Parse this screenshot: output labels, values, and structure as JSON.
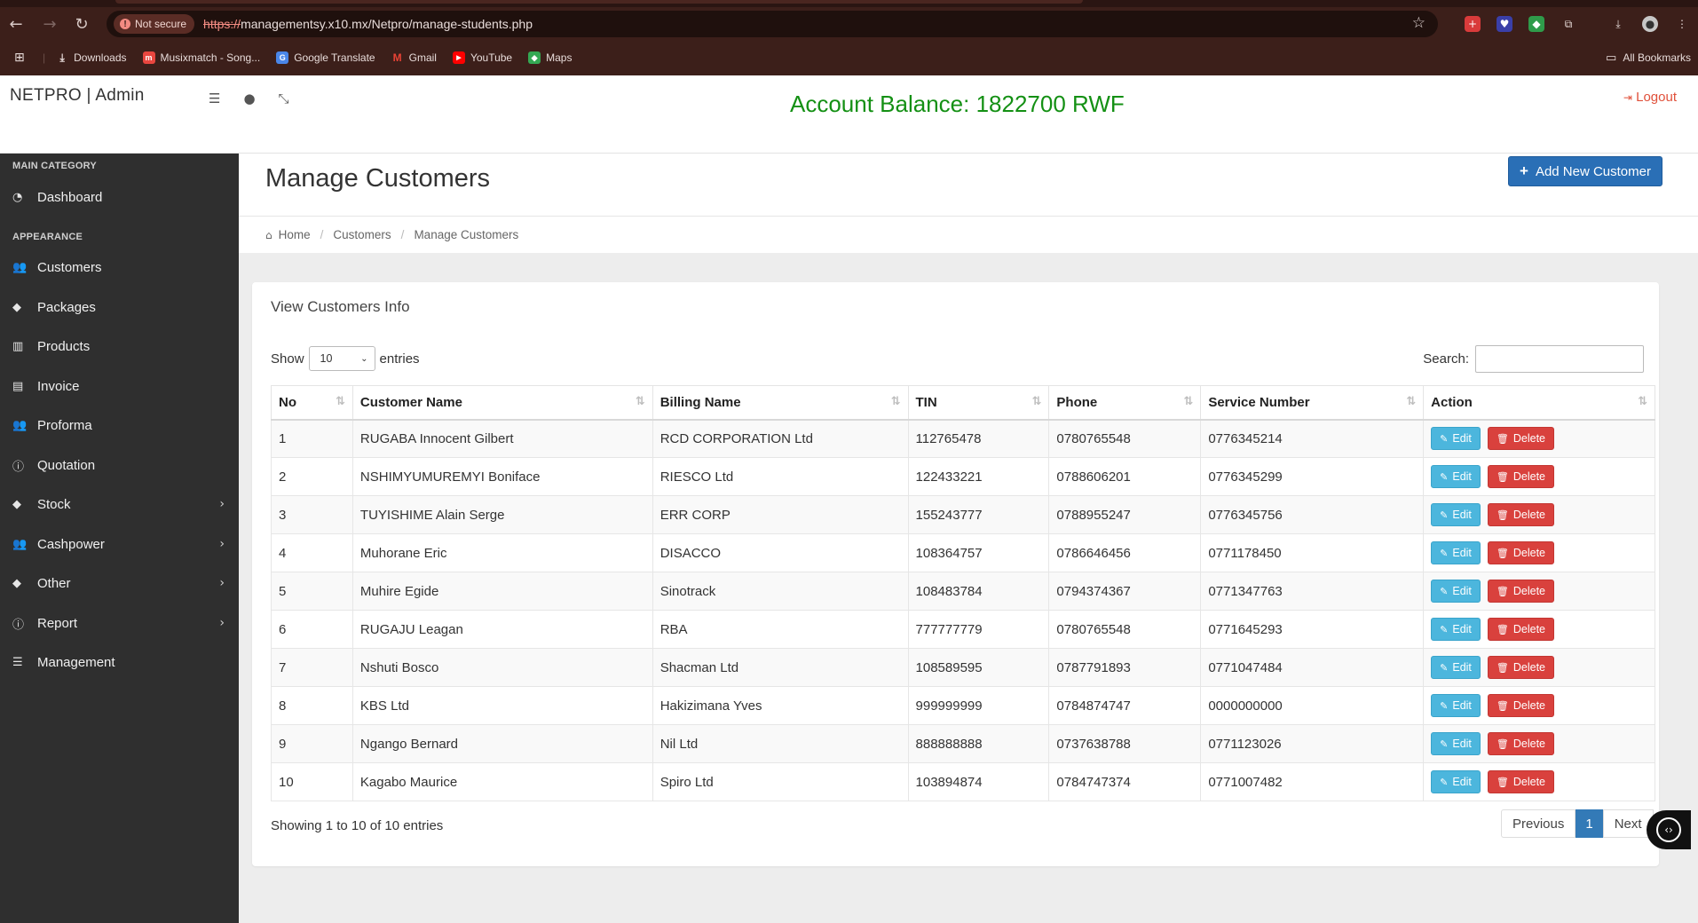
{
  "browser": {
    "not_secure": "Not secure",
    "url_protocol": "https://",
    "url_rest": "managementsy.x10.mx/Netpro/manage-students.php",
    "bookmarks": [
      {
        "label": "Downloads",
        "icon": "download-icon",
        "color": "#e8dcda"
      },
      {
        "label": "Musixmatch - Song...",
        "icon": "musixmatch-icon",
        "color": "#e8463f"
      },
      {
        "label": "Google Translate",
        "icon": "translate-icon",
        "color": "#4a86e8"
      },
      {
        "label": "Gmail",
        "icon": "gmail-icon",
        "color": "#ea4335"
      },
      {
        "label": "YouTube",
        "icon": "youtube-icon",
        "color": "#ff0000"
      },
      {
        "label": "Maps",
        "icon": "maps-icon",
        "color": "#34a853"
      }
    ],
    "all_bookmarks": "All Bookmarks"
  },
  "header": {
    "brand": "NETPRO | Admin",
    "balance": "Account Balance: 1822700 RWF",
    "logout": "Logout"
  },
  "sidebar": {
    "cat_main": "MAIN CATEGORY",
    "cat_appearance": "APPEARANCE",
    "dashboard": "Dashboard",
    "items": [
      {
        "label": "Customers",
        "icon": "users-icon"
      },
      {
        "label": "Packages",
        "icon": "tag-icon"
      },
      {
        "label": "Products",
        "icon": "bank-icon"
      },
      {
        "label": "Invoice",
        "icon": "file-icon"
      },
      {
        "label": "Proforma",
        "icon": "users-icon"
      },
      {
        "label": "Quotation",
        "icon": "info-icon"
      },
      {
        "label": "Stock",
        "icon": "tag-icon"
      },
      {
        "label": "Cashpower",
        "icon": "users-icon"
      },
      {
        "label": "Other",
        "icon": "tag-icon"
      },
      {
        "label": "Report",
        "icon": "info-icon"
      },
      {
        "label": "Management",
        "icon": "list-icon"
      }
    ]
  },
  "page": {
    "title": "Manage Customers",
    "add_button": "Add New Customer",
    "breadcrumb": [
      "Home",
      "Customers",
      "Manage Customers"
    ]
  },
  "card": {
    "title": "View Customers Info",
    "show": "Show",
    "entries_value": "10",
    "entries": "entries",
    "search": "Search:",
    "search_value": ""
  },
  "table": {
    "headers": [
      "No",
      "Customer Name",
      "Billing Name",
      "TIN",
      "Phone",
      "Service Number",
      "Action"
    ],
    "edit_label": "Edit",
    "delete_label": "Delete",
    "rows": [
      [
        "1",
        "RUGABA Innocent Gilbert",
        "RCD CORPORATION Ltd",
        "112765478",
        "0780765548",
        "0776345214"
      ],
      [
        "2",
        "NSHIMYUMUREMYI Boniface",
        "RIESCO Ltd",
        "122433221",
        "0788606201",
        "0776345299"
      ],
      [
        "3",
        "TUYISHIME Alain Serge",
        "ERR CORP",
        "155243777",
        "0788955247",
        "0776345756"
      ],
      [
        "4",
        "Muhorane Eric",
        "DISACCO",
        "108364757",
        "0786646456",
        "0771178450"
      ],
      [
        "5",
        "Muhire Egide",
        "Sinotrack",
        "108483784",
        "0794374367",
        "0771347763"
      ],
      [
        "6",
        "RUGAJU Leagan",
        "RBA",
        "777777779",
        "0780765548",
        "0771645293"
      ],
      [
        "7",
        "Nshuti Bosco",
        "Shacman Ltd",
        "108589595",
        "0787791893",
        "0771047484"
      ],
      [
        "8",
        "KBS Ltd",
        "Hakizimana Yves",
        "999999999",
        "0784874747",
        "0000000000"
      ],
      [
        "9",
        "Ngango Bernard",
        "Nil Ltd",
        "888888888",
        "0737638788",
        "0771123026"
      ],
      [
        "10",
        "Kagabo Maurice",
        "Spiro Ltd",
        "103894874",
        "0784747374",
        "0771007482"
      ]
    ]
  },
  "footer": {
    "info": "Showing 1 to 10 of 10 entries",
    "previous": "Previous",
    "page": "1",
    "next": "Next"
  }
}
